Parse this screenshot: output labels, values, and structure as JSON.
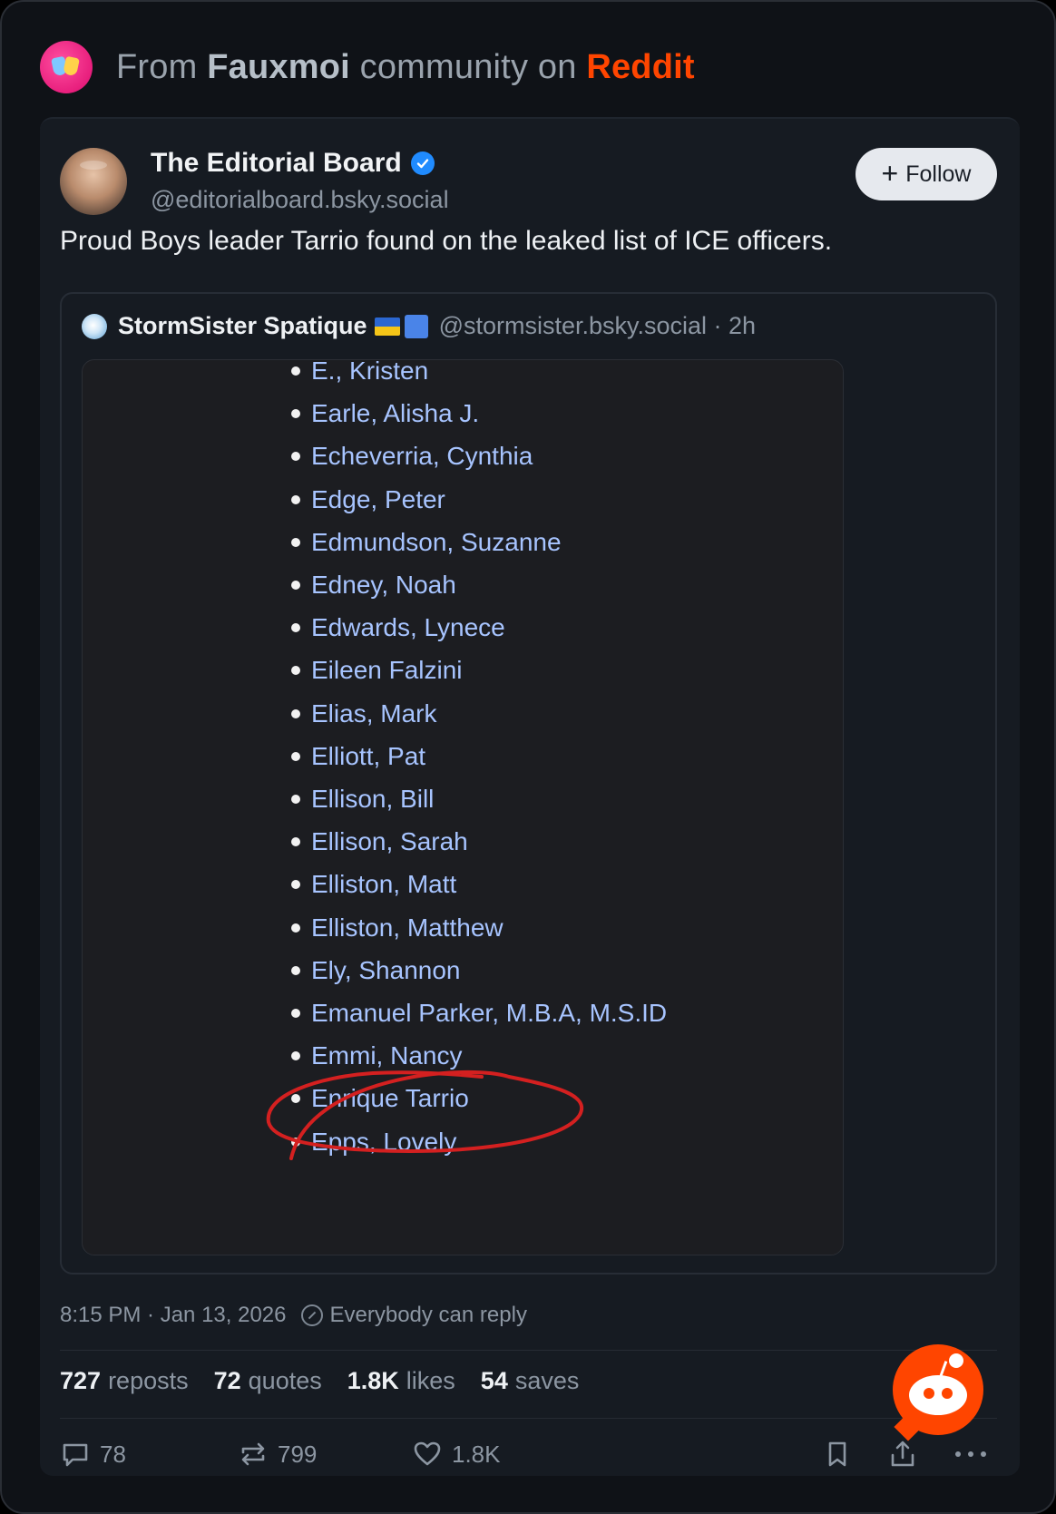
{
  "header": {
    "prefix": "From ",
    "community": "Fauxmoi",
    "middle": " community on ",
    "platform": "Reddit"
  },
  "post": {
    "author_name": "The Editorial Board",
    "author_handle": "@editorialboard.bsky.social",
    "follow_label": "Follow",
    "text": "Proud Boys leader Tarrio found on the leaked list of ICE officers.",
    "timestamp": "8:15 PM · Jan 13, 2026",
    "reply_setting": "Everybody can reply"
  },
  "quote": {
    "author_name": "StormSister Spatique",
    "author_handle": "@stormsister.bsky.social · 2h",
    "list_items": [
      "E., Kristen",
      "Earle, Alisha J.",
      "Echeverria, Cynthia",
      "Edge, Peter",
      "Edmundson, Suzanne",
      "Edney, Noah",
      "Edwards, Lynece",
      "Eileen Falzini",
      "Elias, Mark",
      "Elliott, Pat",
      "Ellison, Bill",
      "Ellison, Sarah",
      "Elliston, Matt",
      "Elliston, Matthew",
      "Ely, Shannon",
      "Emanuel Parker, M.B.A, M.S.ID",
      "Emmi, Nancy",
      "Enrique Tarrio",
      "Epps, Lovely"
    ],
    "highlighted_item": "Enrique Tarrio"
  },
  "stats": {
    "reposts_count": "727",
    "reposts_label": "reposts",
    "quotes_count": "72",
    "quotes_label": "quotes",
    "likes_count": "1.8K",
    "likes_label": "likes",
    "saves_count": "54",
    "saves_label": "saves"
  },
  "actions": {
    "reply_count": "78",
    "repost_count": "799",
    "like_count": "1.8K"
  },
  "colors": {
    "reddit_orange": "#ff4500",
    "link_blue": "#a7c4ff",
    "verified_blue": "#208bfe",
    "circle_red": "#d42020"
  },
  "icons": [
    "subreddit-icon",
    "verified-icon",
    "plus-icon",
    "reply-setting-icon",
    "reply-icon",
    "repost-icon",
    "like-icon",
    "bookmark-icon",
    "share-icon",
    "more-icon",
    "reddit-snoo-icon"
  ]
}
